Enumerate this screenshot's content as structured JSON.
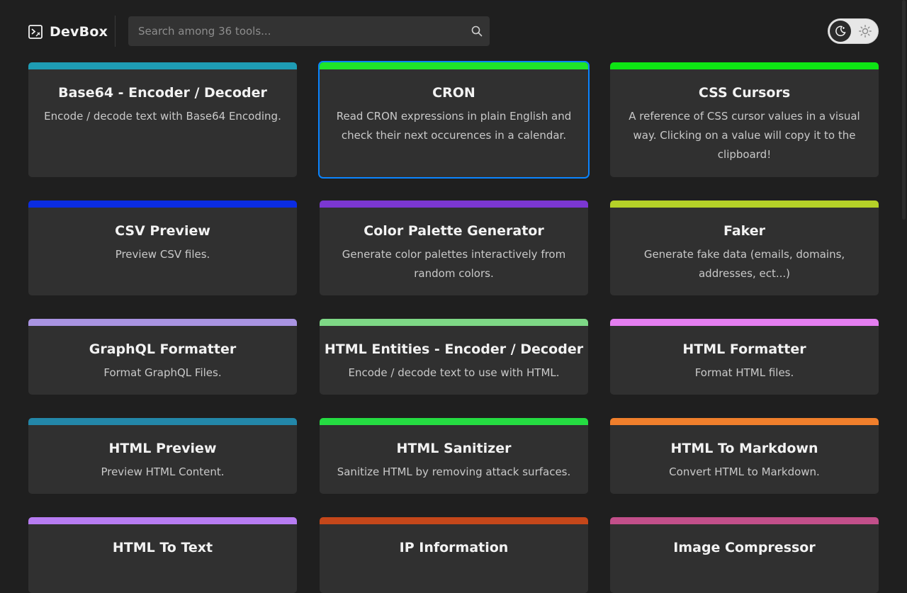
{
  "app": {
    "name": "DevBox"
  },
  "search": {
    "placeholder": "Search among 36 tools..."
  },
  "theme": {
    "current": "dark"
  },
  "tools": [
    {
      "title": "Base64 - Encoder / Decoder",
      "description": "Encode / decode text with Base64 Encoding.",
      "color": "#1e9cb4"
    },
    {
      "title": "CRON",
      "description": "Read CRON expressions in plain English and check their next occurences in a calendar.",
      "color": "#1fe52a",
      "selected": true
    },
    {
      "title": "CSS Cursors",
      "description": "A reference of CSS cursor values in a visual way. Clicking on a value will copy it to the clipboard!",
      "color": "#0ee514"
    },
    {
      "title": "CSV Preview",
      "description": "Preview CSV files.",
      "color": "#0b2ce2"
    },
    {
      "title": "Color Palette Generator",
      "description": "Generate color palettes interactively from random colors.",
      "color": "#7b37d1"
    },
    {
      "title": "Faker",
      "description": "Generate fake data (emails, domains, addresses, ect...)",
      "color": "#b5d128"
    },
    {
      "title": "GraphQL Formatter",
      "description": "Format GraphQL Files.",
      "color": "#a994e2"
    },
    {
      "title": "HTML Entities - Encoder / Decoder",
      "description": "Encode / decode text to use with HTML.",
      "color": "#7ed886"
    },
    {
      "title": "HTML Formatter",
      "description": "Format HTML files.",
      "color": "#e47ef0"
    },
    {
      "title": "HTML Preview",
      "description": "Preview HTML Content.",
      "color": "#2387a9"
    },
    {
      "title": "HTML Sanitizer",
      "description": "Sanitize HTML by removing attack surfaces.",
      "color": "#25dc42"
    },
    {
      "title": "HTML To Markdown",
      "description": "Convert HTML to Markdown.",
      "color": "#f07f2c"
    },
    {
      "title": "HTML To Text",
      "description": "",
      "color": "#b77cf2"
    },
    {
      "title": "IP Information",
      "description": "",
      "color": "#c5471a"
    },
    {
      "title": "Image Compressor",
      "description": "",
      "color": "#c24f8a"
    }
  ]
}
